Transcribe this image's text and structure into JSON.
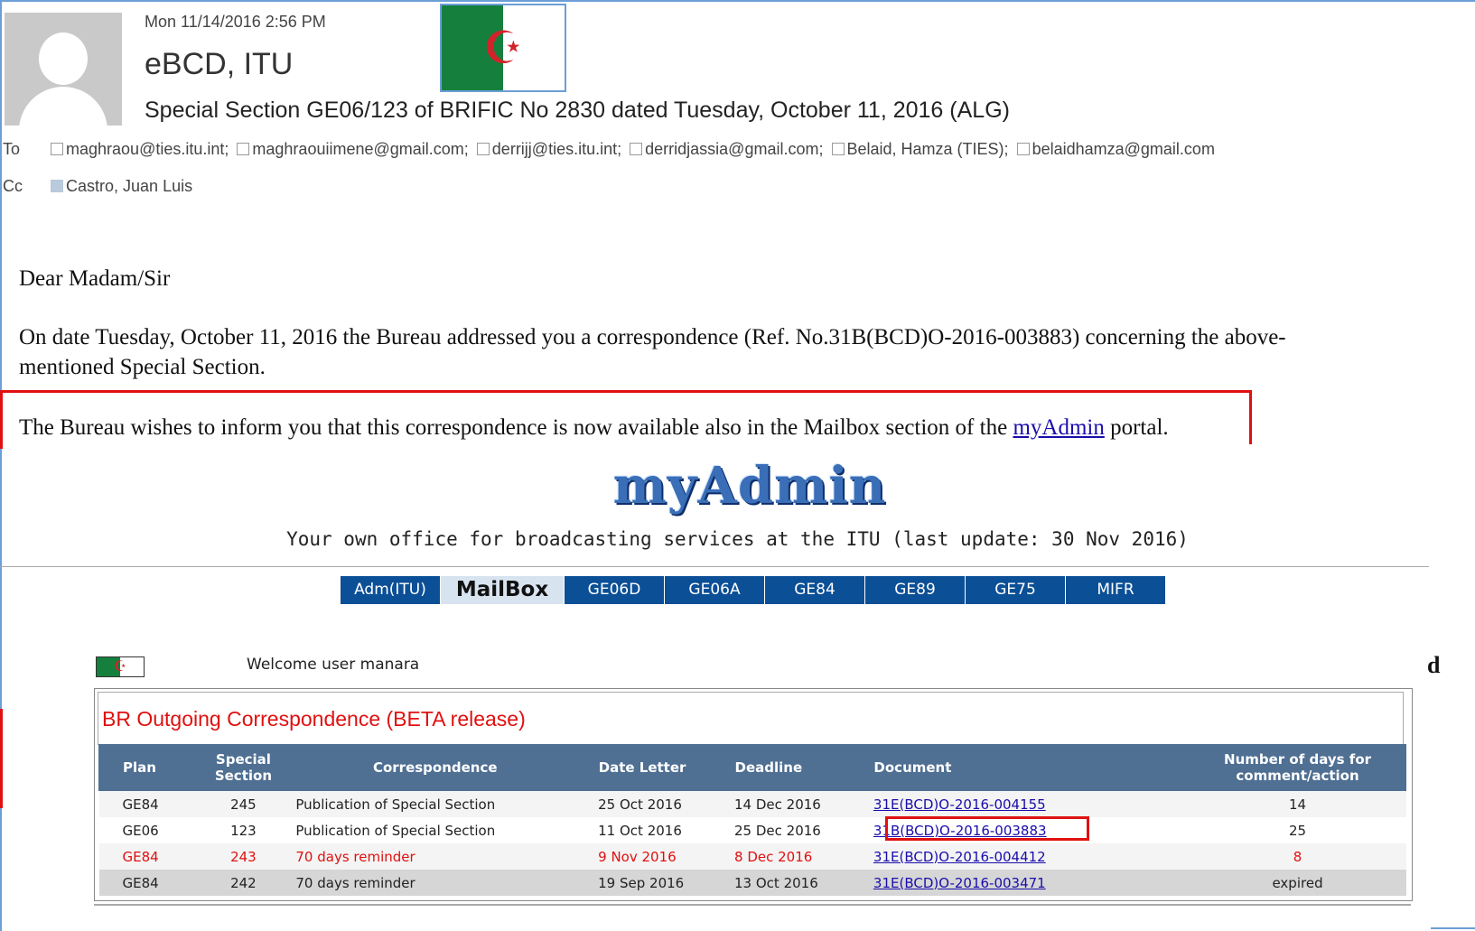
{
  "email": {
    "date": "Mon 11/14/2016 2:56 PM",
    "sender": "eBCD, ITU",
    "subject": "Special Section GE06/123 of BRIFIC No 2830 dated Tuesday, October 11, 2016 (ALG)",
    "to_label": "To",
    "cc_label": "Cc",
    "to": [
      "maghraou@ties.itu.int;",
      "maghraouiimene@gmail.com;",
      "derrijj@ties.itu.int;",
      "derridjassia@gmail.com;",
      "Belaid, Hamza (TIES);",
      "belaidhamza@gmail.com"
    ],
    "cc": [
      "Castro, Juan Luis"
    ],
    "greeting": "Dear Madam/Sir",
    "para1_line1": "On date Tuesday, October 11, 2016 the Bureau addressed you a correspondence (Ref. No.31B(BCD)O-2016-003883) concerning the above-",
    "para1_line2": "mentioned Special Section.",
    "para2_before": "The Bureau wishes to inform you that this correspondence is now available also in the Mailbox section of the ",
    "para2_link": "myAdmin",
    "para2_after": " portal."
  },
  "portal": {
    "logo_text": "myAdmin",
    "tagline": "Your own office for broadcasting services at the ITU (last update: 30 Nov 2016)",
    "nav": [
      "Adm(ITU)",
      "MailBox",
      "GE06D",
      "GE06A",
      "GE84",
      "GE89",
      "GE75",
      "MIFR"
    ],
    "nav_active": "MailBox",
    "welcome": "Welcome user manara",
    "stray_char": "d",
    "panel_title": "BR Outgoing Correspondence (BETA release)",
    "columns": [
      "Plan",
      "Special Section",
      "Correspondence",
      "Date Letter",
      "Deadline",
      "Document",
      "Number of days for comment/action"
    ],
    "rows": [
      {
        "plan": "GE84",
        "section": "245",
        "corr": "Publication of Special Section",
        "date": "25 Oct 2016",
        "deadline": "14 Dec 2016",
        "doc": "31E(BCD)O-2016-004155",
        "days": "14"
      },
      {
        "plan": "GE06",
        "section": "123",
        "corr": "Publication of Special Section",
        "date": "11 Oct 2016",
        "deadline": "25 Dec 2016",
        "doc": "31B(BCD)O-2016-003883",
        "days": "25"
      },
      {
        "plan": "GE84",
        "section": "243",
        "corr": "70 days reminder",
        "date": "9 Nov 2016",
        "deadline": "8 Dec 2016",
        "doc": "31E(BCD)O-2016-004412",
        "days": "8"
      },
      {
        "plan": "GE84",
        "section": "242",
        "corr": "70 days reminder",
        "date": "19 Sep 2016",
        "deadline": "13 Oct 2016",
        "doc": "31E(BCD)O-2016-003471",
        "days": "expired"
      }
    ]
  },
  "colors": {
    "highlight_red": "#e01010",
    "nav_blue": "#0b4f96",
    "table_header": "#4f6f93",
    "link_blue": "#1a0dab"
  }
}
